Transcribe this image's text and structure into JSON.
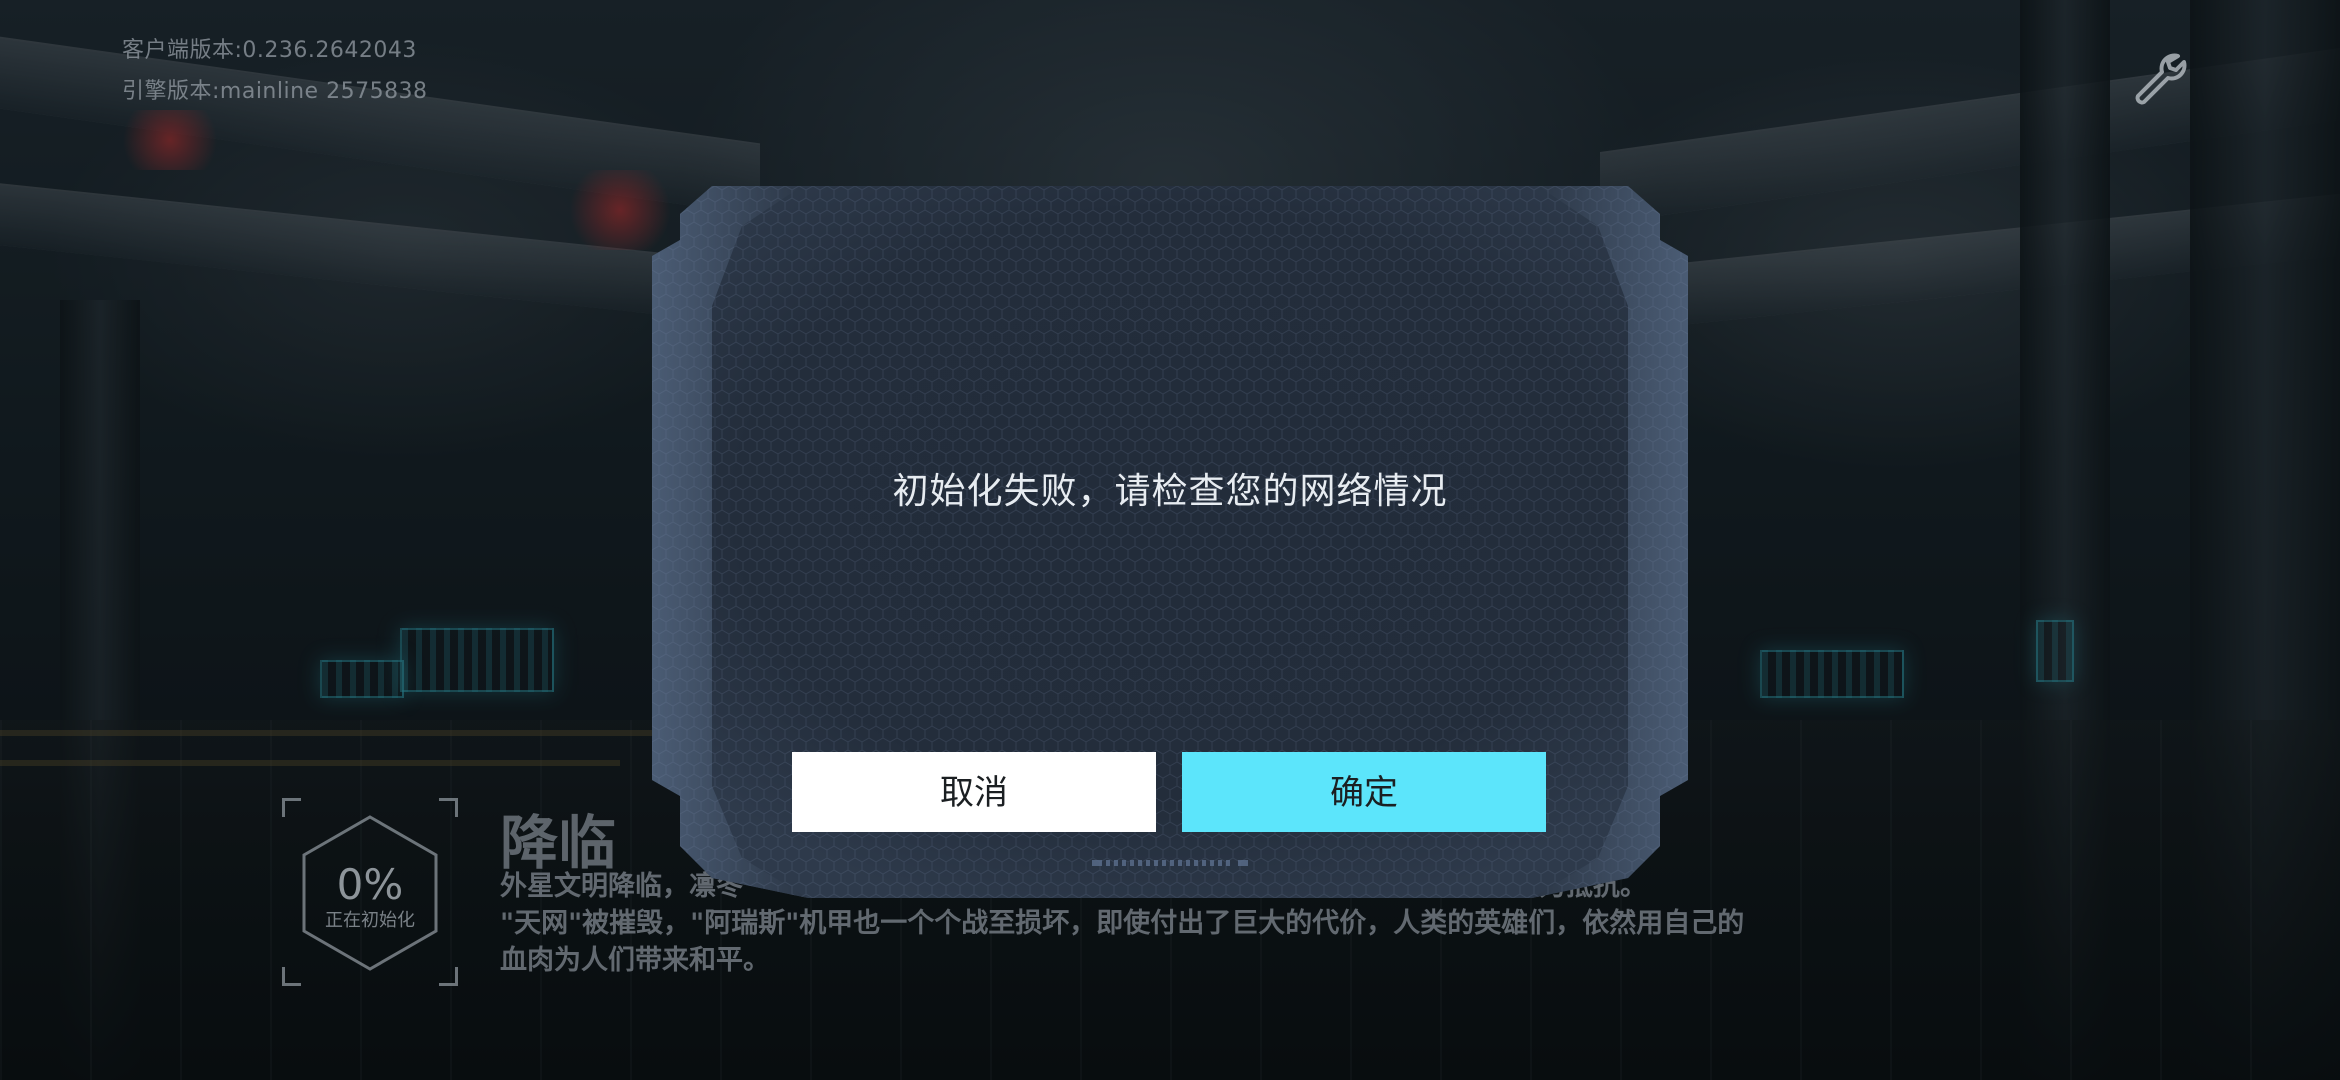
{
  "version": {
    "client": "客户端版本:0.236.2642043",
    "engine": "引擎版本:mainline 2575838"
  },
  "toolbar": {
    "settings_icon": "wrench-icon"
  },
  "loading": {
    "percent": "0%",
    "progress": 0,
    "status": "正在初始化",
    "story_title": "降临",
    "story_lines": [
      "外星文明降临，凛冬",
      "\"天网\"被摧毁，\"阿瑞斯\"机甲也一个个战至损坏，即使付出了巨大的代价，人类的英雄们，依然用自己的",
      "血肉为人们带来和平。"
    ],
    "story_line1_tail": "一起奋力抵抗。"
  },
  "dialog": {
    "message": "初始化失败，请检查您的网络情况",
    "cancel_label": "取消",
    "confirm_label": "确定"
  },
  "colors": {
    "confirm": "#5ce5fb",
    "cancel": "#ffffff",
    "dialog_bg": "#222c39"
  }
}
